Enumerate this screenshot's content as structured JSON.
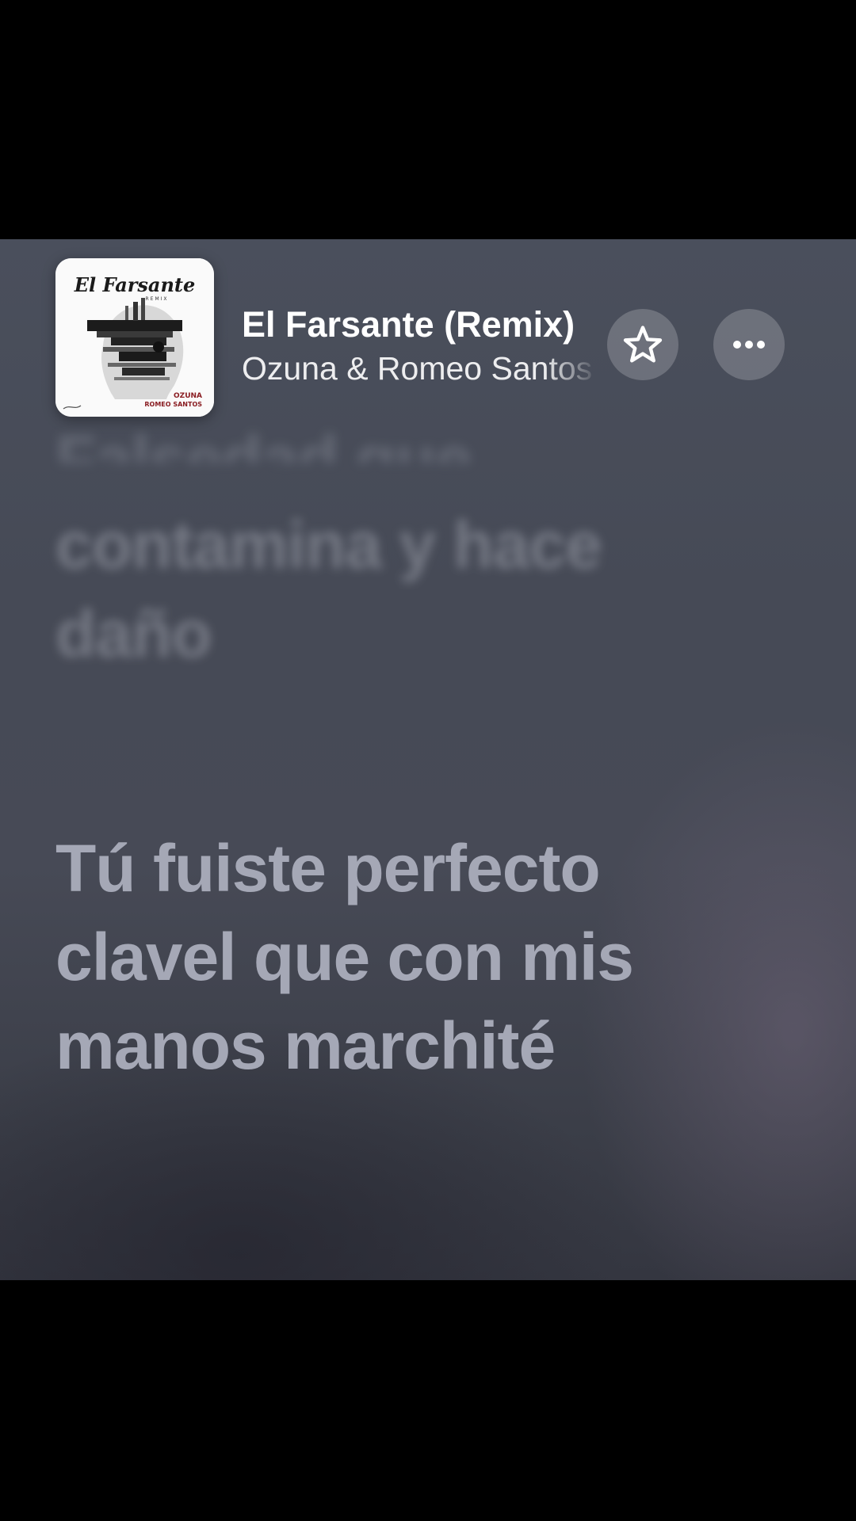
{
  "now_playing": {
    "title": "El Farsante (Remix)",
    "artist": "Ozuna & Romeo Santos",
    "album_art": {
      "title_text": "El Farsante",
      "subtitle_text": "REMIX",
      "credit_line_1": "OZUNA",
      "credit_line_2": "ROMEO SANTOS"
    }
  },
  "buttons": {
    "favorite_icon": "star-outline-icon",
    "more_icon": "ellipsis-icon"
  },
  "lyrics": {
    "previous_partial": "Falsedad que",
    "previous": "contamina y hace daño",
    "current": "Tú fuiste perfecto clavel que con mis manos marchité"
  },
  "colors": {
    "background": "#474b57",
    "current_lyric": "#a5a8b6",
    "title": "#ffffff"
  }
}
